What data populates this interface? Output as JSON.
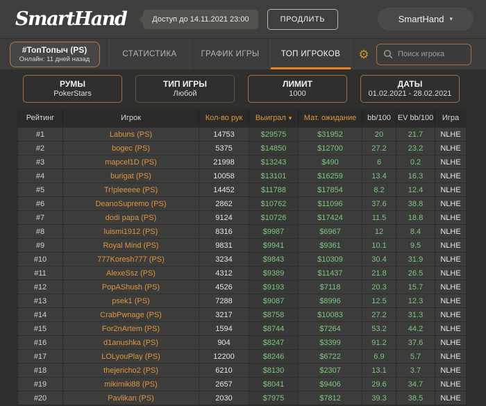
{
  "header": {
    "logo": "SmartHand",
    "access_badge": "Доступ до 14.11.2021 23:00",
    "renew_button": "ПРОДЛИТЬ",
    "account_menu": "SmartHand",
    "chevron": "▾"
  },
  "nav": {
    "profile_tab": {
      "title": "#ТопТопыч (PS)",
      "subtitle": "Онлайн: 11 дней назад"
    },
    "tabs": [
      {
        "label": "СТАТИСТИКА",
        "active": false
      },
      {
        "label": "ГРАФИК ИГРЫ",
        "active": false
      },
      {
        "label": "ТОП ИГРОКОВ",
        "active": true
      }
    ],
    "gear_icon": "⚙",
    "search_placeholder": "Поиск игрока"
  },
  "filters": [
    {
      "label": "РУМЫ",
      "value": "PokerStars"
    },
    {
      "label": "ТИП ИГРЫ",
      "value": "Любой"
    },
    {
      "label": "ЛИМИТ",
      "value": "1000"
    },
    {
      "label": "ДАТЫ",
      "value": "01.02.2021 - 28.02.2021"
    }
  ],
  "table": {
    "columns": [
      {
        "key": "rank",
        "label": "Рейтинг",
        "accent": false,
        "sorted": false
      },
      {
        "key": "player",
        "label": "Игрок",
        "accent": false,
        "sorted": false
      },
      {
        "key": "hands",
        "label": "Кол-во рук",
        "accent": true,
        "sorted": false
      },
      {
        "key": "won",
        "label": "Выиграл",
        "accent": true,
        "sorted": true
      },
      {
        "key": "expected",
        "label": "Мат. ожидание",
        "accent": true,
        "sorted": false
      },
      {
        "key": "bb100",
        "label": "bb/100",
        "accent": false,
        "sorted": false
      },
      {
        "key": "ev_bb100",
        "label": "EV bb/100",
        "accent": false,
        "sorted": false
      },
      {
        "key": "game",
        "label": "Игра",
        "accent": false,
        "sorted": false
      }
    ],
    "sort_icon": "▾",
    "rows": [
      {
        "rank": "#1",
        "player": "Labuns (PS)",
        "hands": "14753",
        "won": "$29575",
        "expected": "$31952",
        "bb100": "20",
        "ev_bb100": "21.7",
        "game": "NLHE"
      },
      {
        "rank": "#2",
        "player": "bogec (PS)",
        "hands": "5375",
        "won": "$14850",
        "expected": "$12700",
        "bb100": "27.2",
        "ev_bb100": "23.2",
        "game": "NLHE"
      },
      {
        "rank": "#3",
        "player": "mapcel1D (PS)",
        "hands": "21998",
        "won": "$13243",
        "expected": "$490",
        "bb100": "6",
        "ev_bb100": "0.2",
        "game": "NLHE"
      },
      {
        "rank": "#4",
        "player": "burigat (PS)",
        "hands": "10058",
        "won": "$13101",
        "expected": "$16259",
        "bb100": "13.4",
        "ev_bb100": "16.3",
        "game": "NLHE"
      },
      {
        "rank": "#5",
        "player": "Tr!pleeeee (PS)",
        "hands": "14452",
        "won": "$11788",
        "expected": "$17854",
        "bb100": "8.2",
        "ev_bb100": "12.4",
        "game": "NLHE"
      },
      {
        "rank": "#6",
        "player": "DeanoSupremo (PS)",
        "hands": "2862",
        "won": "$10762",
        "expected": "$11096",
        "bb100": "37.6",
        "ev_bb100": "38.8",
        "game": "NLHE"
      },
      {
        "rank": "#7",
        "player": "dodi papa (PS)",
        "hands": "9124",
        "won": "$10726",
        "expected": "$17424",
        "bb100": "11.5",
        "ev_bb100": "18.8",
        "game": "NLHE"
      },
      {
        "rank": "#8",
        "player": "luismi1912 (PS)",
        "hands": "8316",
        "won": "$9987",
        "expected": "$6967",
        "bb100": "12",
        "ev_bb100": "8.4",
        "game": "NLHE"
      },
      {
        "rank": "#9",
        "player": "Royal Mind (PS)",
        "hands": "9831",
        "won": "$9941",
        "expected": "$9361",
        "bb100": "10.1",
        "ev_bb100": "9.5",
        "game": "NLHE"
      },
      {
        "rank": "#10",
        "player": "777Koresh777 (PS)",
        "hands": "3234",
        "won": "$9843",
        "expected": "$10309",
        "bb100": "30.4",
        "ev_bb100": "31.9",
        "game": "NLHE"
      },
      {
        "rank": "#11",
        "player": "AlexeSsz (PS)",
        "hands": "4312",
        "won": "$9389",
        "expected": "$11437",
        "bb100": "21.8",
        "ev_bb100": "26.5",
        "game": "NLHE"
      },
      {
        "rank": "#12",
        "player": "PopAShush (PS)",
        "hands": "4526",
        "won": "$9193",
        "expected": "$7118",
        "bb100": "20.3",
        "ev_bb100": "15.7",
        "game": "NLHE"
      },
      {
        "rank": "#13",
        "player": "psek1 (PS)",
        "hands": "7288",
        "won": "$9087",
        "expected": "$8996",
        "bb100": "12.5",
        "ev_bb100": "12.3",
        "game": "NLHE"
      },
      {
        "rank": "#14",
        "player": "CrabPwnage (PS)",
        "hands": "3217",
        "won": "$8758",
        "expected": "$10083",
        "bb100": "27.2",
        "ev_bb100": "31.3",
        "game": "NLHE"
      },
      {
        "rank": "#15",
        "player": "For2nArtem (PS)",
        "hands": "1594",
        "won": "$8744",
        "expected": "$7264",
        "bb100": "53.2",
        "ev_bb100": "44.2",
        "game": "NLHE"
      },
      {
        "rank": "#16",
        "player": "d1anushka (PS)",
        "hands": "904",
        "won": "$8247",
        "expected": "$3399",
        "bb100": "91.2",
        "ev_bb100": "37.6",
        "game": "NLHE"
      },
      {
        "rank": "#17",
        "player": "LOLyouPlay (PS)",
        "hands": "12200",
        "won": "$8246",
        "expected": "$6722",
        "bb100": "6.9",
        "ev_bb100": "5.7",
        "game": "NLHE"
      },
      {
        "rank": "#18",
        "player": "thejericho2 (PS)",
        "hands": "6210",
        "won": "$8130",
        "expected": "$2307",
        "bb100": "13.1",
        "ev_bb100": "3.7",
        "game": "NLHE"
      },
      {
        "rank": "#19",
        "player": "mikimiki88 (PS)",
        "hands": "2657",
        "won": "$8041",
        "expected": "$9406",
        "bb100": "29.6",
        "ev_bb100": "34.7",
        "game": "NLHE"
      },
      {
        "rank": "#20",
        "player": "Pavlikan (PS)",
        "hands": "2030",
        "won": "$7975",
        "expected": "$7812",
        "bb100": "39.3",
        "ev_bb100": "38.5",
        "game": "NLHE"
      }
    ]
  },
  "colors": {
    "accent_orange": "#ef7e1b",
    "link_orange": "#e0953f",
    "positive_green": "#7cc87f",
    "gear_gold": "#c79435",
    "page_bg": "#2f2f2d"
  }
}
